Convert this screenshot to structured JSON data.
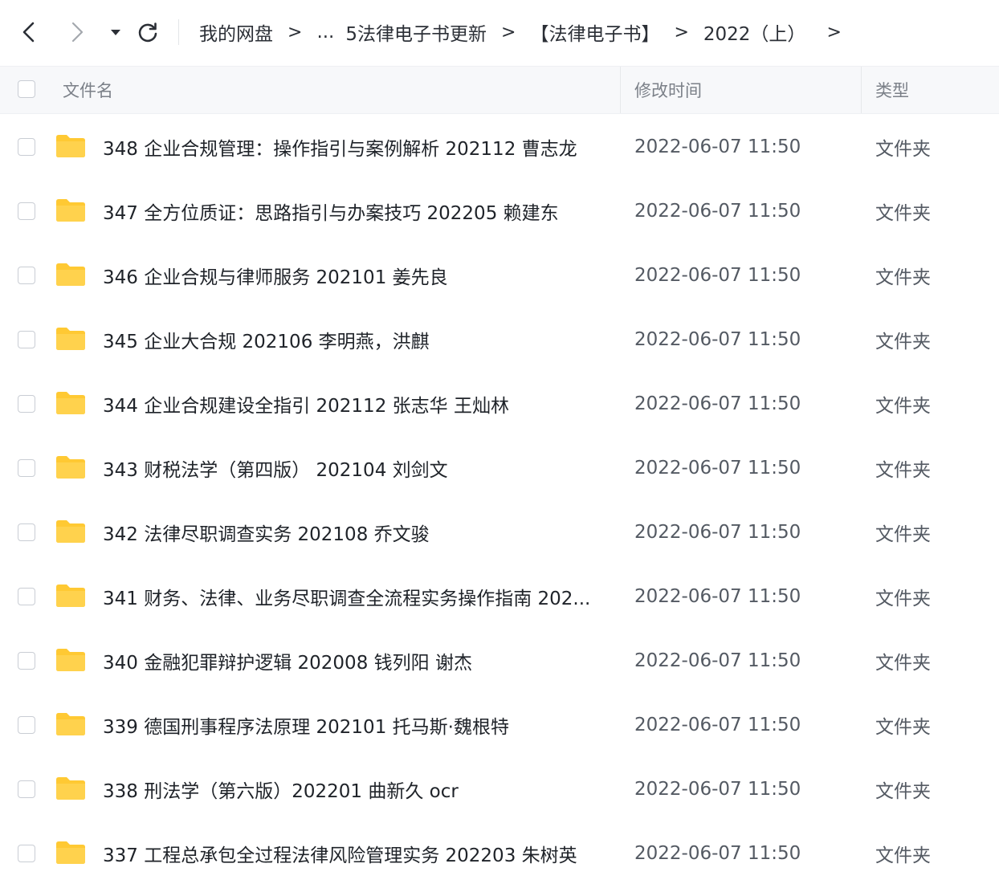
{
  "breadcrumb": {
    "items": [
      "我的网盘",
      "...",
      "5法律电子书更新",
      "【法律电子书】",
      "2022（上）"
    ],
    "separator": ">"
  },
  "table": {
    "headers": {
      "name": "文件名",
      "modified": "修改时间",
      "type": "类型"
    },
    "rows": [
      {
        "name": "348 企业合规管理：操作指引与案例解析 202112 曹志龙",
        "modified": "2022-06-07 11:50",
        "type": "文件夹"
      },
      {
        "name": "347 全方位质证：思路指引与办案技巧 202205 赖建东",
        "modified": "2022-06-07 11:50",
        "type": "文件夹"
      },
      {
        "name": "346 企业合规与律师服务 202101 姜先良",
        "modified": "2022-06-07 11:50",
        "type": "文件夹"
      },
      {
        "name": "345 企业大合规 202106 李明燕，洪麒",
        "modified": "2022-06-07 11:50",
        "type": "文件夹"
      },
      {
        "name": "344 企业合规建设全指引 202112 张志华 王灿林",
        "modified": "2022-06-07 11:50",
        "type": "文件夹"
      },
      {
        "name": "343 财税法学（第四版） 202104 刘剑文",
        "modified": "2022-06-07 11:50",
        "type": "文件夹"
      },
      {
        "name": "342 法律尽职调查实务 202108 乔文骏",
        "modified": "2022-06-07 11:50",
        "type": "文件夹"
      },
      {
        "name": "341 财务、法律、业务尽职调查全流程实务操作指南 202...",
        "modified": "2022-06-07 11:50",
        "type": "文件夹"
      },
      {
        "name": "340 金融犯罪辩护逻辑 202008 钱列阳 谢杰",
        "modified": "2022-06-07 11:50",
        "type": "文件夹"
      },
      {
        "name": "339 德国刑事程序法原理 202101 托马斯·魏根特",
        "modified": "2022-06-07 11:50",
        "type": "文件夹"
      },
      {
        "name": "338 刑法学（第六版）202201 曲新久 ocr",
        "modified": "2022-06-07 11:50",
        "type": "文件夹"
      },
      {
        "name": "337 工程总承包全过程法律风险管理实务 202203 朱树英",
        "modified": "2022-06-07 11:50",
        "type": "文件夹"
      }
    ]
  },
  "icons": {
    "back": "chevron-left-icon",
    "forward": "chevron-right-icon",
    "history": "caret-down-icon",
    "refresh": "refresh-icon",
    "folder": "folder-icon"
  },
  "colors": {
    "folder": "#ffc933",
    "header_bg": "#f7f8fa",
    "checkbox_border": "#c9cdd4"
  }
}
